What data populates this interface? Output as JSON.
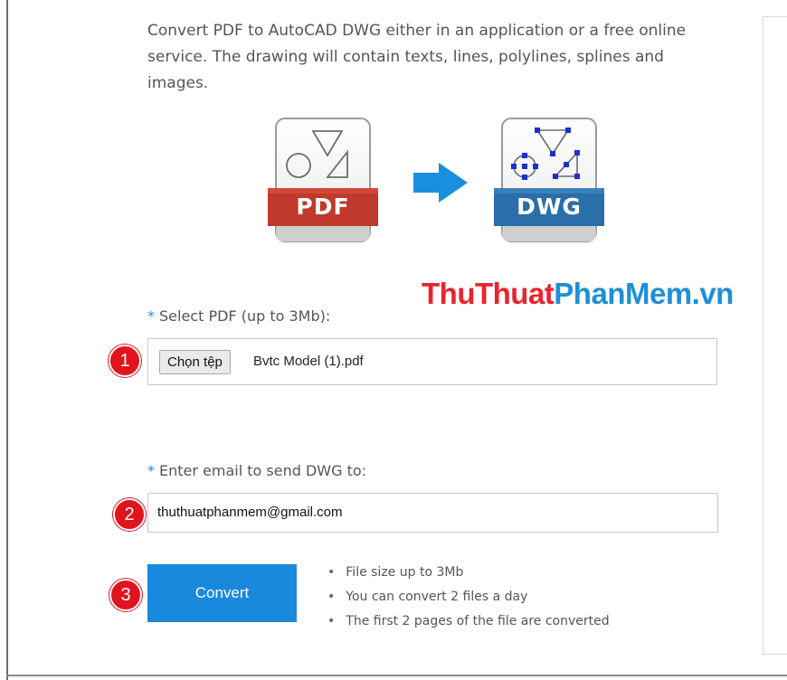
{
  "intro": "Convert PDF to AutoCAD DWG either in an application or a free online service. The drawing will contain texts, lines, polylines, splines and images.",
  "graphic": {
    "source_label": "PDF",
    "target_label": "DWG"
  },
  "watermark": {
    "part1": "ThuThuat",
    "part2": "PhanMem.vn"
  },
  "upload": {
    "required_mark": "*",
    "label": "Select PDF (up to 3Mb):",
    "button_label": "Chọn tệp",
    "file_name": "Bvtc Model (1).pdf"
  },
  "email": {
    "required_mark": "*",
    "label": "Enter email to send DWG to:",
    "value": "thuthuatphanmem@gmail.com"
  },
  "convert_label": "Convert",
  "notes": [
    "File size up to 3Mb",
    "You can convert 2 files a day",
    "The first 2 pages of the file are converted"
  ],
  "steps": [
    "1",
    "2",
    "3"
  ],
  "colors": {
    "pdf_band": "#c0392b",
    "dwg_band": "#2a6fa8",
    "arrow": "#1a8fe0",
    "convert_button": "#1889dd",
    "step_badge": "#e0141c",
    "watermark_red": "#e8242f",
    "watermark_blue": "#1e8fd6"
  }
}
